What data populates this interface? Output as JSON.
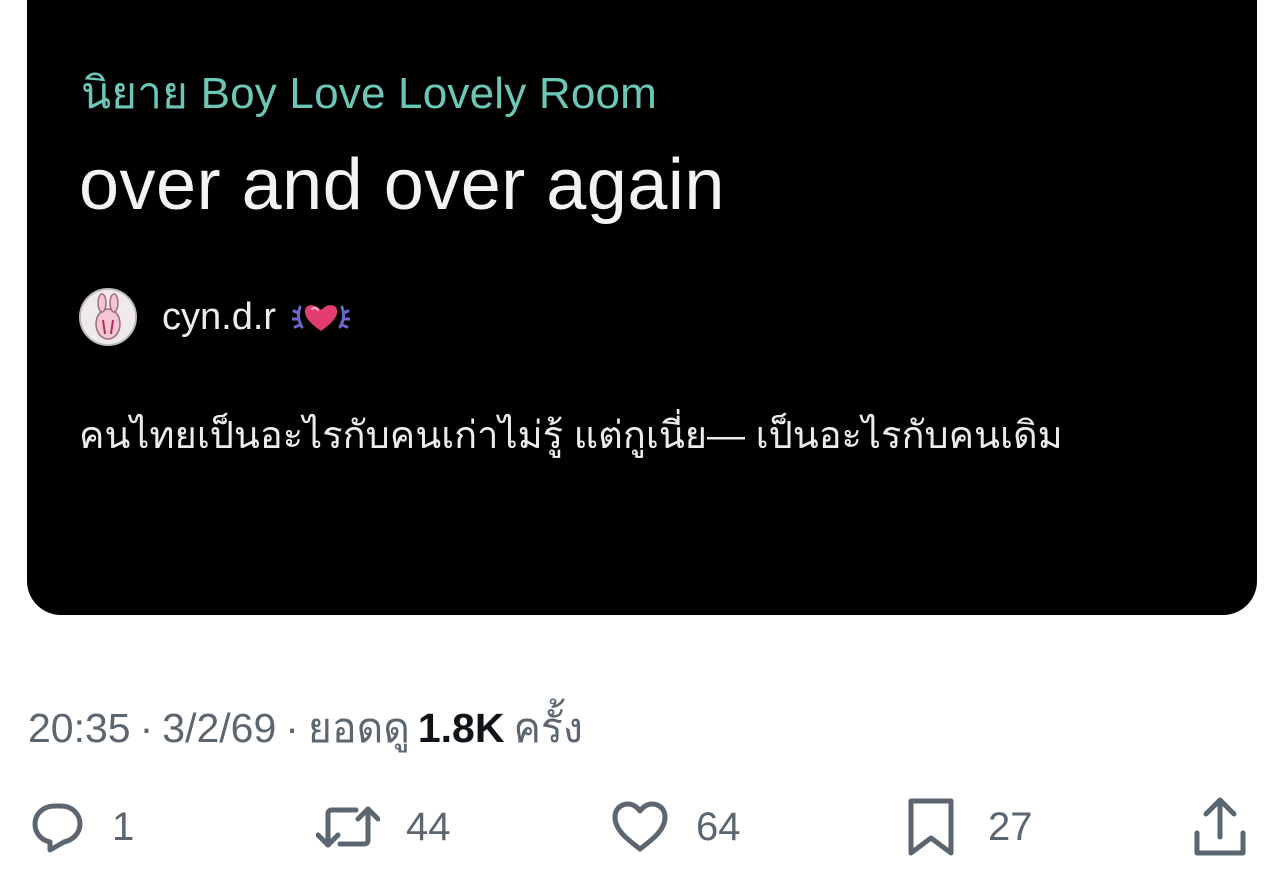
{
  "story": {
    "category": "นิยาย Boy Love Lovely Room",
    "title": "over and over again",
    "author": "cyn.d.r",
    "excerpt": "คนไทยเป็นอะไรกับคนเก่าไม่รู้ แต่กูเนี่ย— เป็นอะไรกับคนเดิม"
  },
  "meta": {
    "time": "20:35",
    "separator": "·",
    "date": "3/2/69",
    "views_label": "ยอดดู",
    "views_count": "1.8K",
    "views_unit": "ครั้ง"
  },
  "actions": {
    "reply_count": "1",
    "repost_count": "44",
    "like_count": "64",
    "bookmark_count": "27"
  },
  "icons": {
    "reply": "reply-icon",
    "repost": "repost-icon",
    "like": "heart-icon",
    "bookmark": "bookmark-icon",
    "share": "share-icon"
  },
  "colors": {
    "category_accent": "#6cc7b7",
    "card_background": "#000000",
    "secondary_text": "#5b6670",
    "primary_text": "#0f1419"
  }
}
